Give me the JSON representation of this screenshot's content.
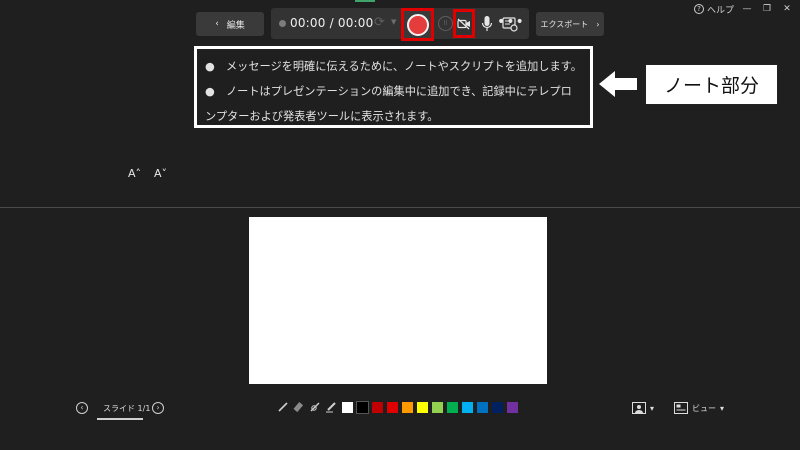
{
  "window": {
    "help_label": "ヘルプ",
    "minimize_glyph": "—",
    "restore_glyph": "❐",
    "close_glyph": "✕"
  },
  "toolbar": {
    "edit_label": "編集",
    "back_chevron": "‹",
    "timer": "00:00 / 00:00",
    "export_label": "エクスポート",
    "export_chevron": "›",
    "more_label": "•••"
  },
  "notes": {
    "lines": [
      "●　メッセージを明確に伝えるために、ノートやスクリプトを追加します。",
      "●　ノートはプレゼンテーションの編集中に追加でき、記録中にテレプロ",
      "ンプターおよび発表者ツールに表示されます。"
    ]
  },
  "callout": {
    "label": "ノート部分"
  },
  "font_controls": {
    "increase_label": "A˄",
    "decrease_label": "A˅"
  },
  "slide_nav": {
    "counter": "スライド 1/1",
    "prev_glyph": "‹",
    "next_glyph": "›"
  },
  "colors": {
    "record": "#e53c3c",
    "highlight_frame": "#e00000",
    "swatches": [
      "#ffffff",
      "#000000",
      "#c00000",
      "#e00000",
      "#ff9900",
      "#ffff00",
      "#92d050",
      "#00b050",
      "#00b0f0",
      "#0070c0",
      "#002060",
      "#7030a0"
    ]
  },
  "bottom_right": {
    "presenter_caret": "▾",
    "view_label": "ビュー",
    "view_caret": "▾"
  },
  "icons": [
    "help-icon",
    "reload-icon",
    "record-icon",
    "pause-icon",
    "camera-off-icon",
    "microphone-icon",
    "display-settings-icon",
    "pen-icon",
    "eraser-icon",
    "laser-pointer-icon",
    "highlighter-icon",
    "presenter-icon",
    "view-icon"
  ]
}
